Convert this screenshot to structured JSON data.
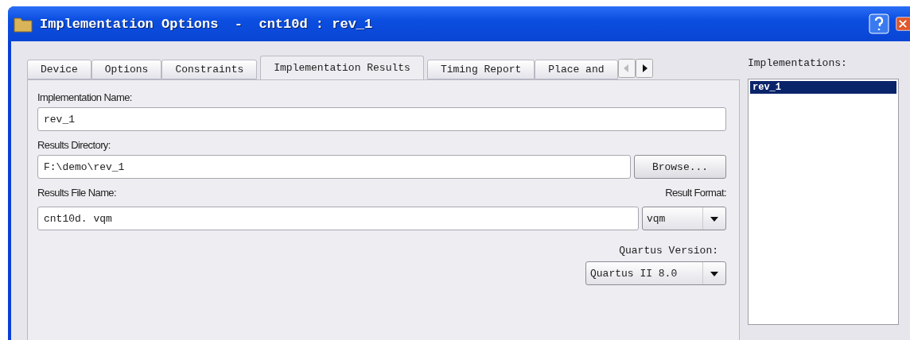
{
  "window": {
    "title": "Implementation Options  -  cnt10d : rev_1"
  },
  "tabs": [
    {
      "label": "Device",
      "selected": false
    },
    {
      "label": "Options",
      "selected": false
    },
    {
      "label": "Constraints",
      "selected": false
    },
    {
      "label": "Implementation Results",
      "selected": true
    },
    {
      "label": "Timing Report",
      "selected": false
    },
    {
      "label": "Place and",
      "selected": false
    }
  ],
  "tab_scroll": {
    "left_disabled": true,
    "right_disabled": false
  },
  "form": {
    "implementation_name": {
      "label": "Implementation Name:",
      "value": "rev_1"
    },
    "results_directory": {
      "label": "Results Directory:",
      "value": "F:\\demo\\rev_1",
      "button": "Browse..."
    },
    "results_file_name": {
      "label": "Results File Name:",
      "value": "cnt10d. vqm"
    },
    "result_format": {
      "label": "Result Format:",
      "value": "vqm"
    },
    "quartus_version": {
      "label": "Quartus Version:",
      "value": "Quartus II 8.0"
    }
  },
  "implementations": {
    "label": "Implementations:",
    "items": [
      {
        "label": "rev_1",
        "selected": true
      }
    ]
  }
}
